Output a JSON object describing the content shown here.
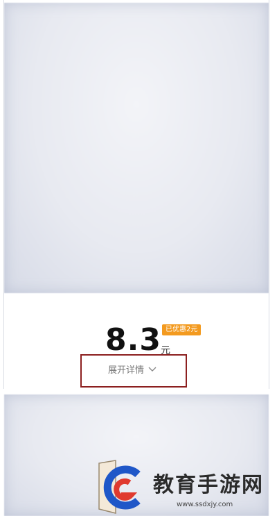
{
  "price": {
    "value": "8.3",
    "unit": "元",
    "discount_badge": "已优惠2元"
  },
  "details": {
    "expand_label": "展开详情"
  },
  "watermark": {
    "site_name": "教育手游网",
    "url": "www.ssdxjy.com"
  },
  "colors": {
    "badge": "#f39a1f",
    "highlight_box": "#8c1f1f",
    "brand_blue": "#1f57c8",
    "brand_red": "#e03a2f"
  },
  "icons": {
    "expand": "chevron-down-icon",
    "logo": "site-logo-icon"
  }
}
